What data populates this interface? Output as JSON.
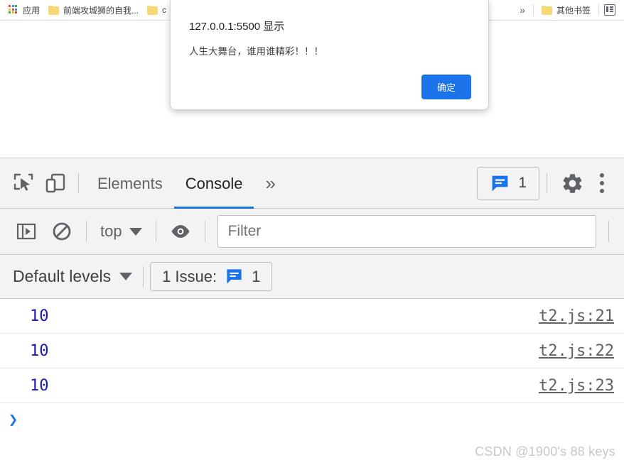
{
  "browser": {
    "bookmarks_bar": {
      "apps_label": "应用",
      "apps_icon": "apps-grid-icon",
      "apps_colors": [
        "#ea4335",
        "#4285f4",
        "#34a853",
        "#fbbc05",
        "#ea4335",
        "#4285f4",
        "#34a853",
        "#fbbc05",
        "#ea4335"
      ],
      "items": [
        {
          "label": "前端攻城狮的自我...",
          "icon": "folder-icon"
        },
        {
          "label": "c",
          "icon": "folder-icon"
        }
      ],
      "overflow_label": "»",
      "other_bookmarks": {
        "label": "其他书签",
        "icon": "folder-icon"
      },
      "reading_list_icon": "reading-list-icon"
    }
  },
  "alert": {
    "origin": "127.0.0.1:5500 显示",
    "message": "人生大舞台，谁用谁精彩！！！",
    "ok_label": "确定",
    "accent": "#1a73e8"
  },
  "devtools": {
    "toolbar": {
      "inspect_icon": "inspect-element-icon",
      "device_icon": "device-toolbar-icon",
      "tabs": [
        {
          "label": "Elements",
          "active": false
        },
        {
          "label": "Console",
          "active": true
        }
      ],
      "more_tabs_label": "»",
      "issues_badge": {
        "icon": "message-icon",
        "count": "1"
      },
      "settings_icon": "gear-icon",
      "menu_icon": "kebab-menu-icon",
      "accent": "#1a73e8"
    },
    "console_toolbar": {
      "sidebar_icon": "console-sidebar-icon",
      "clear_icon": "clear-console-icon",
      "context_label": "top",
      "context_caret": "▼",
      "eye_icon": "live-expression-eye-icon",
      "filter_placeholder": "Filter",
      "filter_value": ""
    },
    "levels_toolbar": {
      "levels_label": "Default levels",
      "levels_caret": "▼",
      "issue_text": "1 Issue:",
      "issue_icon": "message-icon",
      "issue_count": "1"
    },
    "console_messages": [
      {
        "value": "10",
        "source": "t2.js:21"
      },
      {
        "value": "10",
        "source": "t2.js:22"
      },
      {
        "value": "10",
        "source": "t2.js:23"
      }
    ],
    "prompt": {
      "caret": "❯",
      "value": "",
      "placeholder": ""
    },
    "watermark": "CSDN @1900's 88 keys"
  }
}
